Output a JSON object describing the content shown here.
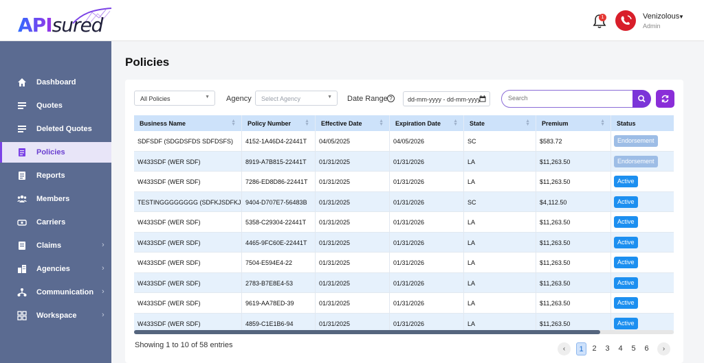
{
  "header": {
    "logo_api": "API",
    "logo_sured": "sured",
    "notification_count": "1",
    "user_name": "Venizolous",
    "user_role": "Admin"
  },
  "sidebar": {
    "items": [
      {
        "label": "Dashboard",
        "icon": "home-icon"
      },
      {
        "label": "Quotes",
        "icon": "quotes-icon"
      },
      {
        "label": "Deleted Quotes",
        "icon": "deleted-quotes-icon"
      },
      {
        "label": "Policies",
        "icon": "policies-icon",
        "active": true
      },
      {
        "label": "Reports",
        "icon": "reports-icon"
      },
      {
        "label": "Members",
        "icon": "members-icon"
      },
      {
        "label": "Carriers",
        "icon": "carriers-icon"
      },
      {
        "label": "Claims",
        "icon": "claims-icon",
        "chevron": true
      },
      {
        "label": "Agencies",
        "icon": "agencies-icon",
        "chevron": true
      },
      {
        "label": "Communication",
        "icon": "communication-icon",
        "chevron": true
      },
      {
        "label": "Workspace",
        "icon": "workspace-icon",
        "chevron": true
      }
    ]
  },
  "page": {
    "title": "Policies"
  },
  "filters": {
    "policy_select": "All Policies",
    "agency_label": "Agency",
    "agency_placeholder": "Select Agency",
    "date_range_label": "Date Range",
    "date_placeholder": "dd-mm-yyyy - dd-mm-yyyy",
    "search_placeholder": "Search"
  },
  "table": {
    "columns": [
      "Business Name",
      "Policy Number",
      "Effective Date",
      "Expiration Date",
      "State",
      "Premium",
      "Status"
    ],
    "rows": [
      [
        "SDFSDF (SDGDSFDS SDFDSFS)",
        "4152-1A46D4-22441T",
        "04/05/2025",
        "04/05/2026",
        "SC",
        "$583.72",
        "Endorsement"
      ],
      [
        "W433SDF (WER SDF)",
        "8919-A7B815-22441T",
        "01/31/2025",
        "01/31/2026",
        "LA",
        "$11,263.50",
        "Endorsement"
      ],
      [
        "W433SDF (WER SDF)",
        "7286-ED8D86-22441T",
        "01/31/2025",
        "01/31/2026",
        "LA",
        "$11,263.50",
        "Active"
      ],
      [
        "TESTINGGGGGGGG (SDFKJSDFKJD...",
        "9404-D707E7-56483B",
        "01/31/2025",
        "01/31/2026",
        "SC",
        "$4,112.50",
        "Active"
      ],
      [
        "W433SDF (WER SDF)",
        "5358-C29304-22441T",
        "01/31/2025",
        "01/31/2026",
        "LA",
        "$11,263.50",
        "Active"
      ],
      [
        "W433SDF (WER SDF)",
        "4465-9FC60E-22441T",
        "01/31/2025",
        "01/31/2026",
        "LA",
        "$11,263.50",
        "Active"
      ],
      [
        "W433SDF (WER SDF)",
        "7504-E594E4-22",
        "01/31/2025",
        "01/31/2026",
        "LA",
        "$11,263.50",
        "Active"
      ],
      [
        "W433SDF (WER SDF)",
        "2783-B7E8E4-53",
        "01/31/2025",
        "01/31/2026",
        "LA",
        "$11,263.50",
        "Active"
      ],
      [
        "W433SDF (WER SDF)",
        "9619-AA78ED-39",
        "01/31/2025",
        "01/31/2026",
        "LA",
        "$11,263.50",
        "Active"
      ],
      [
        "W433SDF (WER SDF)",
        "4859-C1E1B6-94",
        "01/31/2025",
        "01/31/2026",
        "LA",
        "$11,263.50",
        "Active"
      ]
    ]
  },
  "footer": {
    "entries_text": "Showing 1 to 10 of 58 entries",
    "pages": [
      "1",
      "2",
      "3",
      "4",
      "5",
      "6"
    ],
    "current_page": "1",
    "prev_arrow": "‹",
    "next_arrow": "›"
  },
  "colors": {
    "sidebar_bg": "#5b6b91",
    "accent": "#7b35d8",
    "header_row": "#cde2fa",
    "active_badge": "#1c8ff0",
    "endorsement_badge": "#9dbde6"
  }
}
